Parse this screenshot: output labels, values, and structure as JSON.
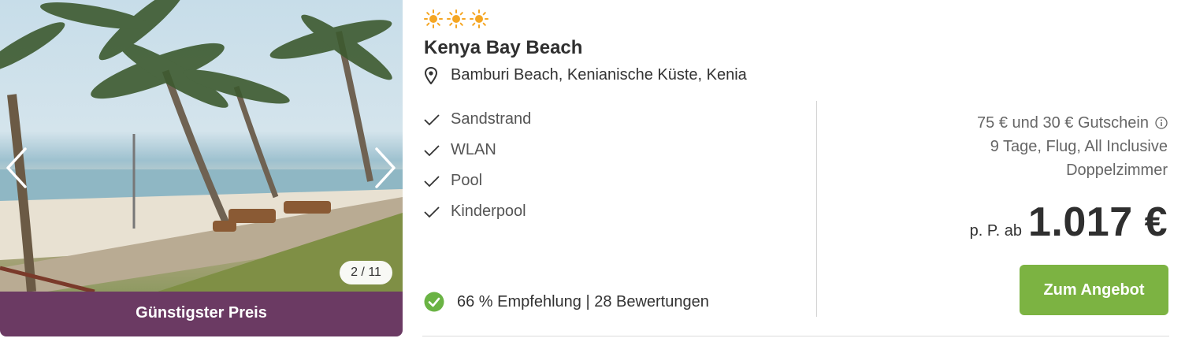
{
  "gallery": {
    "counter": "2 / 11",
    "badge": "Günstigster Preis"
  },
  "hotel": {
    "stars": 3,
    "star_icon": "sun-icon",
    "name": "Kenya Bay Beach",
    "location_icon": "map-pin-icon",
    "location": "Bamburi Beach, Kenianische Küste, Kenia"
  },
  "features": [
    {
      "label": "Sandstrand"
    },
    {
      "label": "WLAN"
    },
    {
      "label": "Pool"
    },
    {
      "label": "Kinderpool"
    }
  ],
  "recommendation": {
    "text": "66 % Empfehlung | 28 Bewertungen"
  },
  "offer": {
    "voucher": "75 € und 30 € Gutschein",
    "details": "9 Tage, Flug, All Inclusive",
    "room": "Doppelzimmer",
    "price_prefix": "p. P. ab",
    "price": "1.017 €",
    "cta": "Zum Angebot"
  },
  "colors": {
    "badge_bg": "#6b3a63",
    "cta_bg": "#7cb342",
    "star": "#f5a623",
    "check_circle": "#6ab344"
  }
}
